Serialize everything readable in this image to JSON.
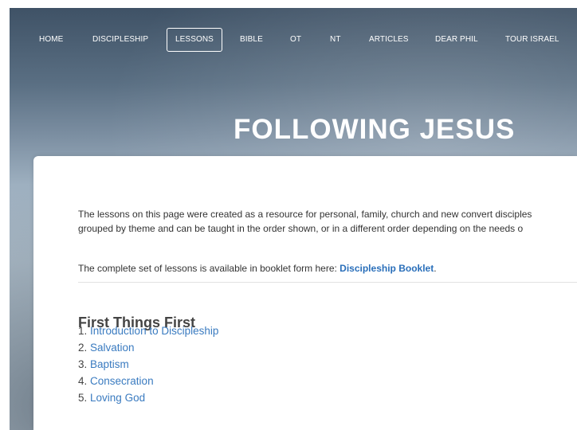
{
  "nav": {
    "items": [
      {
        "label": "HOME"
      },
      {
        "label": "DISCIPLESHIP"
      },
      {
        "label": "LESSONS"
      },
      {
        "label": "BIBLE"
      },
      {
        "label": "OT"
      },
      {
        "label": "NT"
      },
      {
        "label": "ARTICLES"
      },
      {
        "label": "DEAR PHIL"
      },
      {
        "label": "TOUR ISRAEL"
      }
    ],
    "active": "LESSONS"
  },
  "header": {
    "title": "FOLLOWING JESUS"
  },
  "content": {
    "intro_line1": "The lessons on this page were created as a resource for personal, family, church and new convert disciples",
    "intro_line2": "grouped by theme and can be taught in the order shown, or in a different order depending on the needs o",
    "booklet_text": "The complete set of lessons is available in booklet form here: ",
    "booklet_link": "Discipleship Booklet",
    "booklet_suffix": ".",
    "section": {
      "heading": "First Things First",
      "lessons": [
        {
          "number": "1.",
          "title": "Introduction to Discipleship"
        },
        {
          "number": "2.",
          "title": "Salvation"
        },
        {
          "number": "3.",
          "title": "Baptism"
        },
        {
          "number": "4.",
          "title": "Consecration"
        },
        {
          "number": "5.",
          "title": "Loving God"
        }
      ]
    }
  },
  "colors": {
    "link": "#3a7bc0",
    "nav_text": "#ffffff",
    "heading_text": "#ffffff"
  }
}
